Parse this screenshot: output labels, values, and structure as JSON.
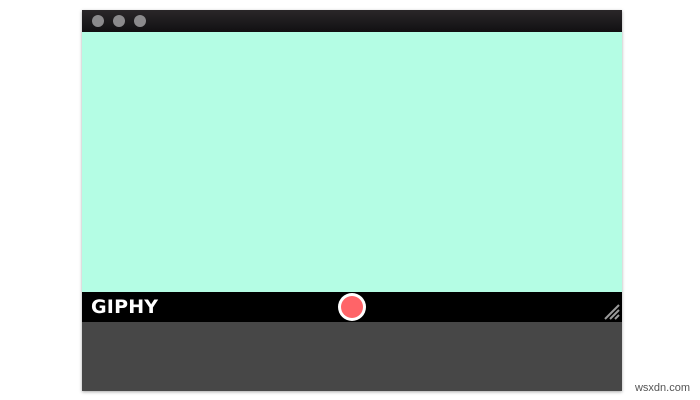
{
  "app": {
    "logo_text": "GIPHY"
  },
  "window_controls": [
    {
      "name": "close-button",
      "color": "#8b8a8c"
    },
    {
      "name": "minimize-button",
      "color": "#8b8a8c"
    },
    {
      "name": "zoom-button",
      "color": "#8b8a8c"
    }
  ],
  "colors": {
    "capture_area": "#b4fde4",
    "control_bar": "#000000",
    "record": "#ff6468",
    "bottom_panel": "#474747"
  },
  "icons": {
    "record": "record-icon",
    "resize": "resize-grip-icon"
  },
  "watermark": "wsxdn.com"
}
